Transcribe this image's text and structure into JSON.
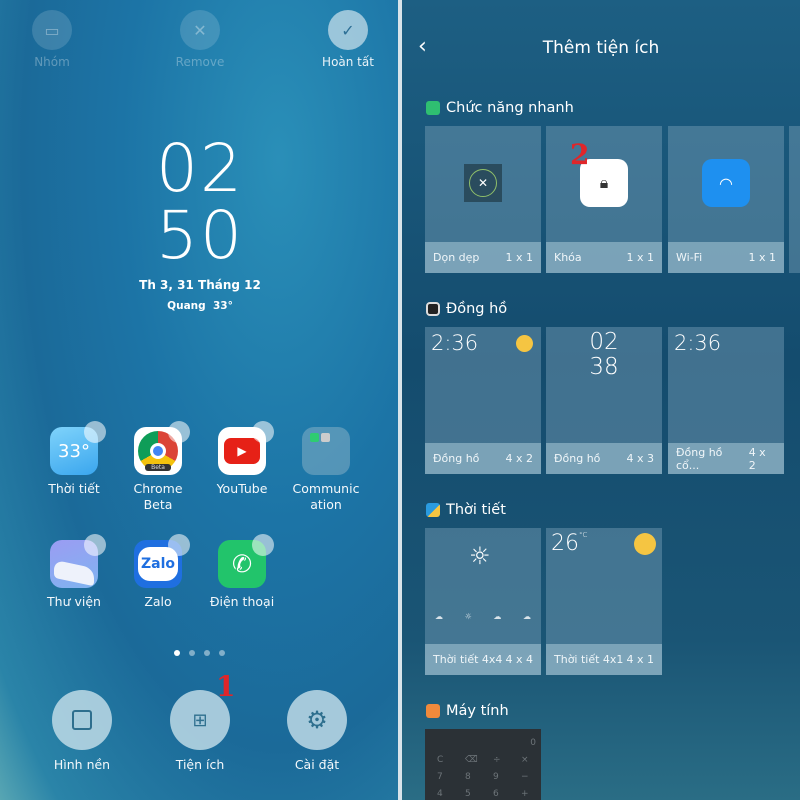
{
  "home": {
    "top_actions": [
      {
        "label": "Nhóm",
        "icon": "folder-icon"
      },
      {
        "label": "Remove",
        "icon": "close-icon"
      },
      {
        "label": "Hoàn tất",
        "icon": "check-icon"
      }
    ],
    "clock": {
      "hour": "02",
      "minute": "50",
      "date": "Th 3, 31 Tháng 12",
      "weather": "Quang  33°"
    },
    "apps": [
      {
        "label": "Thời tiết",
        "badge": "33°",
        "color": "#4fb8f2"
      },
      {
        "label": "Chrome Beta",
        "badge": "Beta",
        "color": "#ffffff"
      },
      {
        "label": "YouTube",
        "color": "#ffffff"
      },
      {
        "label": "Communic ation",
        "color": "#5a9bbb"
      },
      {
        "label": "Thư viện",
        "color": "#8aa8f0"
      },
      {
        "label": "Zalo",
        "badge": "Zalo",
        "color": "#ffffff"
      },
      {
        "label": "Điện thoại",
        "color": "#2ecc71"
      }
    ],
    "page_indicator": {
      "pages": 4,
      "current": 1
    },
    "bottom_actions": [
      {
        "label": "Hình nền",
        "icon": "wallpaper-icon"
      },
      {
        "label": "Tiện ích",
        "icon": "widgets-icon"
      },
      {
        "label": "Cài đặt",
        "icon": "gear-icon"
      }
    ],
    "annotation": "1"
  },
  "widgets": {
    "title": "Thêm tiện ích",
    "annotation": "2",
    "sections": [
      {
        "title": "Chức năng nhanh",
        "icon_color": "#2fbf71",
        "items": [
          {
            "name": "Dọn dẹp",
            "size": "1 x 1"
          },
          {
            "name": "Khóa",
            "size": "1 x 1"
          },
          {
            "name": "Wi-Fi",
            "size": "1 x 1"
          }
        ]
      },
      {
        "title": "Đồng hồ",
        "icon_color": "#222222",
        "items": [
          {
            "name": "Đồng hồ",
            "size": "4 x 2",
            "preview": "2:36"
          },
          {
            "name": "Đồng hồ",
            "size": "4 x 3",
            "preview_h": "02",
            "preview_m": "38"
          },
          {
            "name": "Đồng hồ cổ...",
            "size": "4 x 2",
            "preview": "2:36"
          }
        ]
      },
      {
        "title": "Thời tiết",
        "icon_color": "#2a9be0",
        "items": [
          {
            "name": "Thời tiết 4x4",
            "size": "4 x 4"
          },
          {
            "name": "Thời tiết 4x1",
            "size": "4 x 1",
            "preview": "26",
            "unit": "°C"
          }
        ]
      },
      {
        "title": "Máy tính",
        "icon_color": "#f08a3c",
        "items": [
          {
            "display": "0",
            "keys": [
              "C",
              "⌫",
              "÷",
              "×",
              "7",
              "8",
              "9",
              "−",
              "4",
              "5",
              "6",
              "+"
            ]
          }
        ]
      }
    ]
  }
}
